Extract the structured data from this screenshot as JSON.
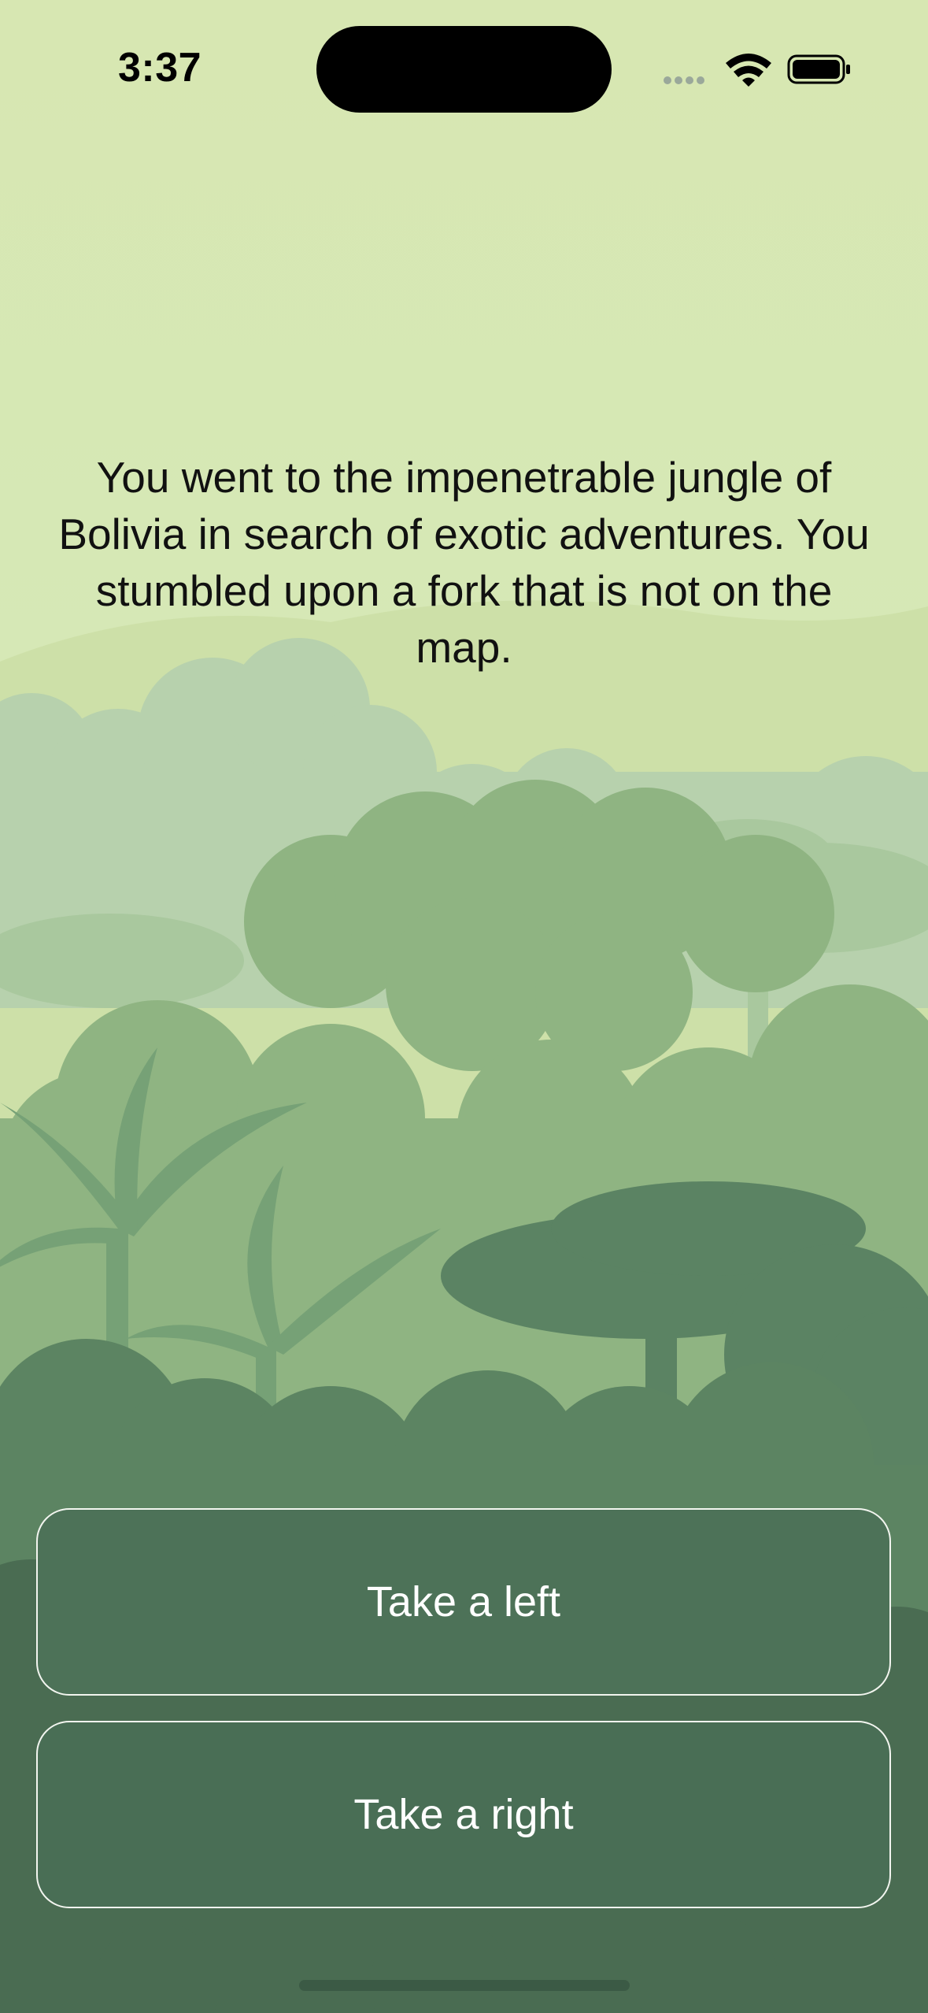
{
  "status_bar": {
    "time": "3:37",
    "icons": [
      "cellular-signal-icon",
      "wifi-icon",
      "battery-icon"
    ]
  },
  "story": {
    "text": "You went to the impenetrable jungle of Bolivia in search of exotic adventures. You stumbled upon a fork that is not on the map."
  },
  "choices": {
    "left_label": "Take a left",
    "right_label": "Take a right"
  },
  "colors": {
    "sky": "#d7e7b2",
    "button_fill": "#4d7258",
    "button_border": "#f2f5ef",
    "button_text": "#ffffff",
    "story_text": "#111111"
  }
}
